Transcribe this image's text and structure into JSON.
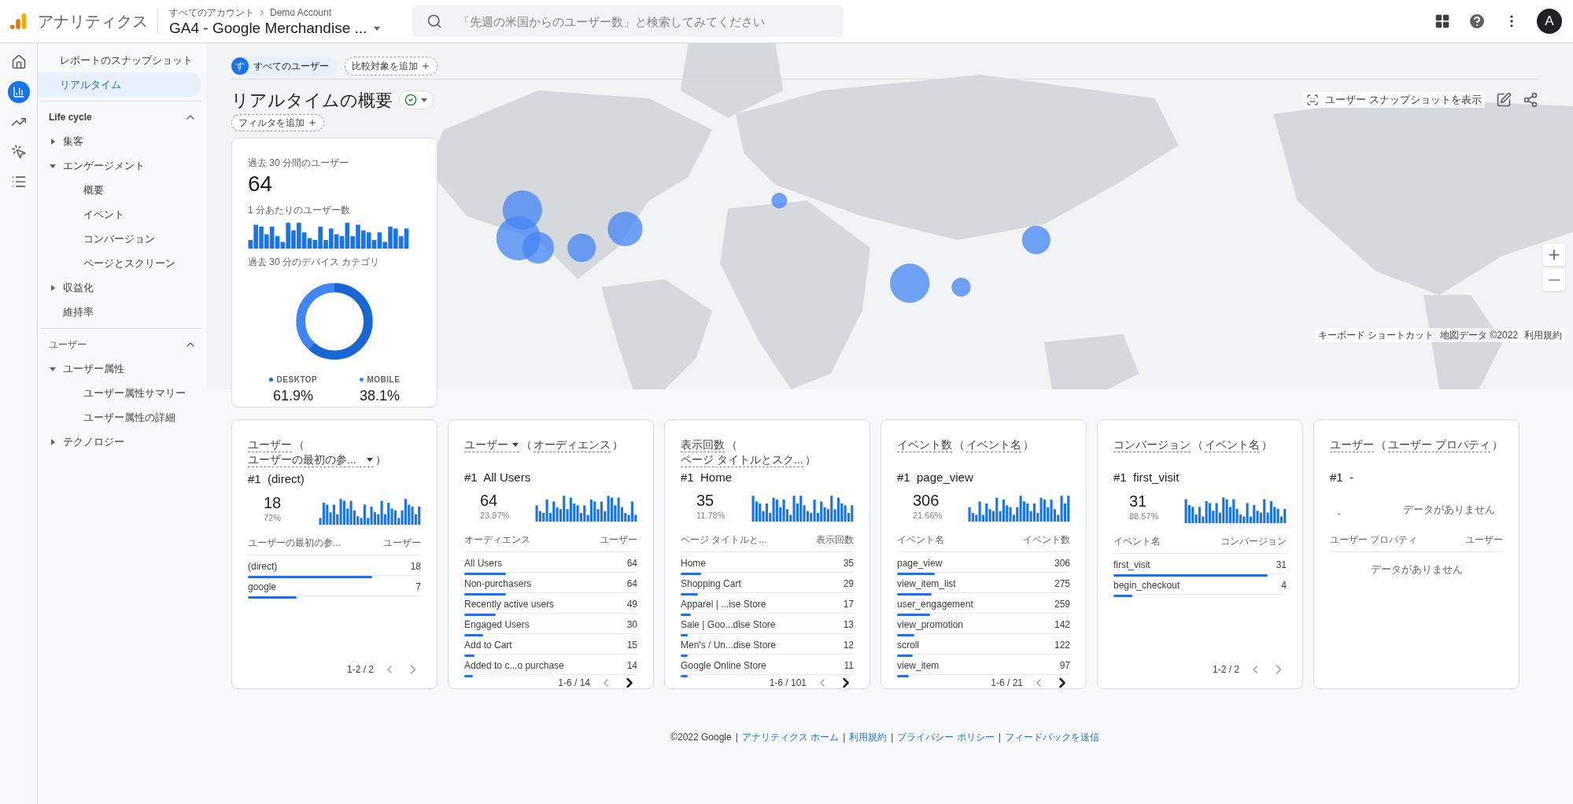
{
  "header": {
    "product": "アナリティクス",
    "breadcrumb": [
      "すべてのアカウント",
      "Demo Account"
    ],
    "property": "GA4 - Google Merchandise ...",
    "search": {
      "placeholder": "「先週の米国からのユーザー数」と検索してみてください"
    },
    "avatar": "A"
  },
  "rail": [
    {
      "kind": "home",
      "selected": false
    },
    {
      "kind": "reports",
      "selected": true
    },
    {
      "kind": "explore",
      "selected": false
    },
    {
      "kind": "advertising",
      "selected": false
    },
    {
      "kind": "configure",
      "selected": false
    }
  ],
  "sidebar": {
    "items": [
      {
        "label": "レポートのスナップショット",
        "selected": false
      },
      {
        "label": "リアルタイム",
        "selected": true
      }
    ],
    "sections": [
      {
        "title": "Life cycle",
        "expanded": true,
        "items": [
          {
            "label": "集客",
            "expanded": false,
            "selected": false
          },
          {
            "label": "エンゲージメント",
            "expanded": true,
            "selected": false,
            "children": [
              {
                "label": "概要",
                "selected": false
              },
              {
                "label": "イベント",
                "selected": false
              },
              {
                "label": "コンバージョン",
                "selected": false
              },
              {
                "label": "ページとスクリーン",
                "selected": false
              }
            ]
          },
          {
            "label": "収益化",
            "expanded": false,
            "selected": false
          },
          {
            "label": "維持率",
            "selected": false
          }
        ]
      },
      {
        "title": "ユーザー",
        "expanded": true,
        "items": [
          {
            "label": "ユーザー属性",
            "expanded": true,
            "selected": false,
            "children": [
              {
                "label": "ユーザー属性サマリー",
                "selected": false
              },
              {
                "label": "ユーザー属性の詳細",
                "selected": false
              }
            ]
          },
          {
            "label": "テクノロジー",
            "expanded": false,
            "selected": false
          }
        ]
      }
    ]
  },
  "comparisons": {
    "segment_badge": "す",
    "segment": "すべてのユーザー",
    "add": "比較対象を追加"
  },
  "title": "リアルタイムの概要",
  "filter": "フィルタを追加",
  "snapshot": "ユーザー スナップショットを表示",
  "map": {
    "attribution": [
      "キーボード ショートカット",
      "地図データ ©2022",
      "利用規約"
    ]
  },
  "realtime_card": {
    "users_label": "過去 30 分間のユーザー",
    "users": "64",
    "per_minute_label": "1 分あたりのユーザー数",
    "device_label": "過去 30 分のデバイス カテゴリ",
    "devices": [
      {
        "name": "DESKTOP",
        "value": "61.9%",
        "level": 0.619,
        "color": "#1967d2"
      },
      {
        "name": "MOBILE",
        "value": "38.1%",
        "level": 0.381,
        "color": "#4285f4"
      }
    ]
  },
  "cards": [
    {
      "kind": "data",
      "metric": "ユーザー",
      "metric_dropdown": false,
      "open": "（",
      "dimension": "ユーザーの最初の参...",
      "dimension_dropdown": true,
      "close": "）",
      "top": {
        "rank": "#1",
        "name": "(direct)",
        "value": "18",
        "percent": "72%"
      },
      "columns": [
        "ユーザーの最初の参...",
        "ユーザー"
      ],
      "rows": [
        {
          "label": "(direct)",
          "value": "18",
          "level": 0.72
        },
        {
          "label": "google",
          "value": "7",
          "level": 0.28
        }
      ],
      "pagination": "1-2 / 2",
      "next_enabled": false
    },
    {
      "kind": "data",
      "metric": "ユーザー",
      "metric_dropdown": true,
      "open": "（",
      "dimension": "オーディエンス",
      "dimension_dropdown": false,
      "close": "）",
      "top": {
        "rank": "#1",
        "name": "All Users",
        "value": "64",
        "percent": "23.97%"
      },
      "columns": [
        "オーディエンス",
        "ユーザー"
      ],
      "rows": [
        {
          "label": "All Users",
          "value": "64",
          "level": 0.24
        },
        {
          "label": "Non-purchasers",
          "value": "64",
          "level": 0.24
        },
        {
          "label": "Recently active users",
          "value": "49",
          "level": 0.18
        },
        {
          "label": "Engaged Users",
          "value": "30",
          "level": 0.11
        },
        {
          "label": "Add to Cart",
          "value": "15",
          "level": 0.06
        },
        {
          "label": "Added to c...o purchase",
          "value": "14",
          "level": 0.05
        }
      ],
      "pagination": "1-6 / 14",
      "next_enabled": true
    },
    {
      "kind": "data",
      "metric": "表示回数",
      "metric_dropdown": false,
      "open": "（",
      "dimension": "ページ タイトルとスク...",
      "dimension_dropdown": false,
      "close": "）",
      "top": {
        "rank": "#1",
        "name": "Home",
        "value": "35",
        "percent": "11.78%"
      },
      "columns": [
        "ページ タイトルと...",
        "表示回数"
      ],
      "rows": [
        {
          "label": "Home",
          "value": "35",
          "level": 0.12
        },
        {
          "label": "Shopping Cart",
          "value": "29",
          "level": 0.1
        },
        {
          "label": "Apparel | ...ise Store",
          "value": "17",
          "level": 0.06
        },
        {
          "label": "Sale | Goo...dise Store",
          "value": "13",
          "level": 0.04
        },
        {
          "label": "Men's / Un...dise Store",
          "value": "12",
          "level": 0.04
        },
        {
          "label": "Google Online Store",
          "value": "11",
          "level": 0.04
        }
      ],
      "pagination": "1-6 / 101",
      "next_enabled": true
    },
    {
      "kind": "data",
      "metric": "イベント数",
      "metric_dropdown": false,
      "open": "（",
      "dimension": "イベント名",
      "dimension_dropdown": false,
      "close": "）",
      "top": {
        "rank": "#1",
        "name": "page_view",
        "value": "306",
        "percent": "21.66%"
      },
      "columns": [
        "イベント名",
        "イベント数"
      ],
      "rows": [
        {
          "label": "page_view",
          "value": "306",
          "level": 0.22
        },
        {
          "label": "view_item_list",
          "value": "275",
          "level": 0.2
        },
        {
          "label": "user_engagement",
          "value": "259",
          "level": 0.19
        },
        {
          "label": "view_promotion",
          "value": "142",
          "level": 0.1
        },
        {
          "label": "scroll",
          "value": "122",
          "level": 0.09
        },
        {
          "label": "view_item",
          "value": "97",
          "level": 0.07
        }
      ],
      "pagination": "1-6 / 21",
      "next_enabled": true
    },
    {
      "kind": "data",
      "metric": "コンバージョン",
      "metric_dropdown": false,
      "open": "（",
      "dimension": "イベント名",
      "dimension_dropdown": false,
      "close": "）",
      "top": {
        "rank": "#1",
        "name": "first_visit",
        "value": "31",
        "percent": "88.57%"
      },
      "columns": [
        "イベント名",
        "コンバージョン"
      ],
      "rows": [
        {
          "label": "first_visit",
          "value": "31",
          "level": 0.89
        },
        {
          "label": "begin_checkout",
          "value": "4",
          "level": 0.11
        }
      ],
      "pagination": "1-2 / 2",
      "next_enabled": false
    },
    {
      "kind": "empty",
      "metric": "ユーザー",
      "metric_dropdown": false,
      "open": "（",
      "dimension": "ユーザー プロパティ",
      "dimension_dropdown": false,
      "close": "）",
      "top": {
        "rank": "#1",
        "name": "-"
      },
      "placeholder_mark": "-",
      "empty_top": "データがありません",
      "columns": [
        "ユーザー プロパティ",
        "ユーザー"
      ],
      "empty_table": "データがありません"
    }
  ],
  "footer": {
    "copyright": "©2022 Google",
    "separator": "|",
    "links": [
      "アナリティクス ホーム",
      "利用規約",
      "プライバシー ポリシー",
      "フィードバックを送信"
    ]
  }
}
